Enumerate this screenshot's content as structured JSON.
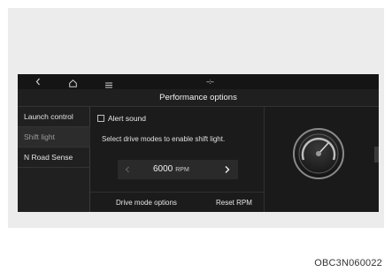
{
  "topbar": {
    "back_icon": "chevron-left-icon",
    "home_icon": "home-icon",
    "menu_icon": "menu-icon",
    "status_glyph": "--:--"
  },
  "header": {
    "title": "Performance options"
  },
  "sidebar": {
    "items": [
      {
        "label": "Launch control",
        "active": false
      },
      {
        "label": "Shift light",
        "active": true
      },
      {
        "label": "N Road Sense",
        "active": false
      }
    ]
  },
  "content": {
    "alert_sound": {
      "label": "Alert sound",
      "checked": false
    },
    "instruction": "Select drive modes to enable shift light.",
    "rpm": {
      "value": "6000",
      "unit": "RPM",
      "prev_icon": "chevron-left-icon",
      "next_icon": "chevron-right-icon"
    },
    "footer": {
      "drive_mode_options": "Drive mode options",
      "reset_rpm": "Reset RPM"
    }
  },
  "gauge": {
    "icon": "shift-light-gauge-icon"
  },
  "caption": "OBC3N060022",
  "colors": {
    "screen_bg": "#1b1b1b",
    "text": "#f2f2f2",
    "panel_bg": "#ececec"
  }
}
